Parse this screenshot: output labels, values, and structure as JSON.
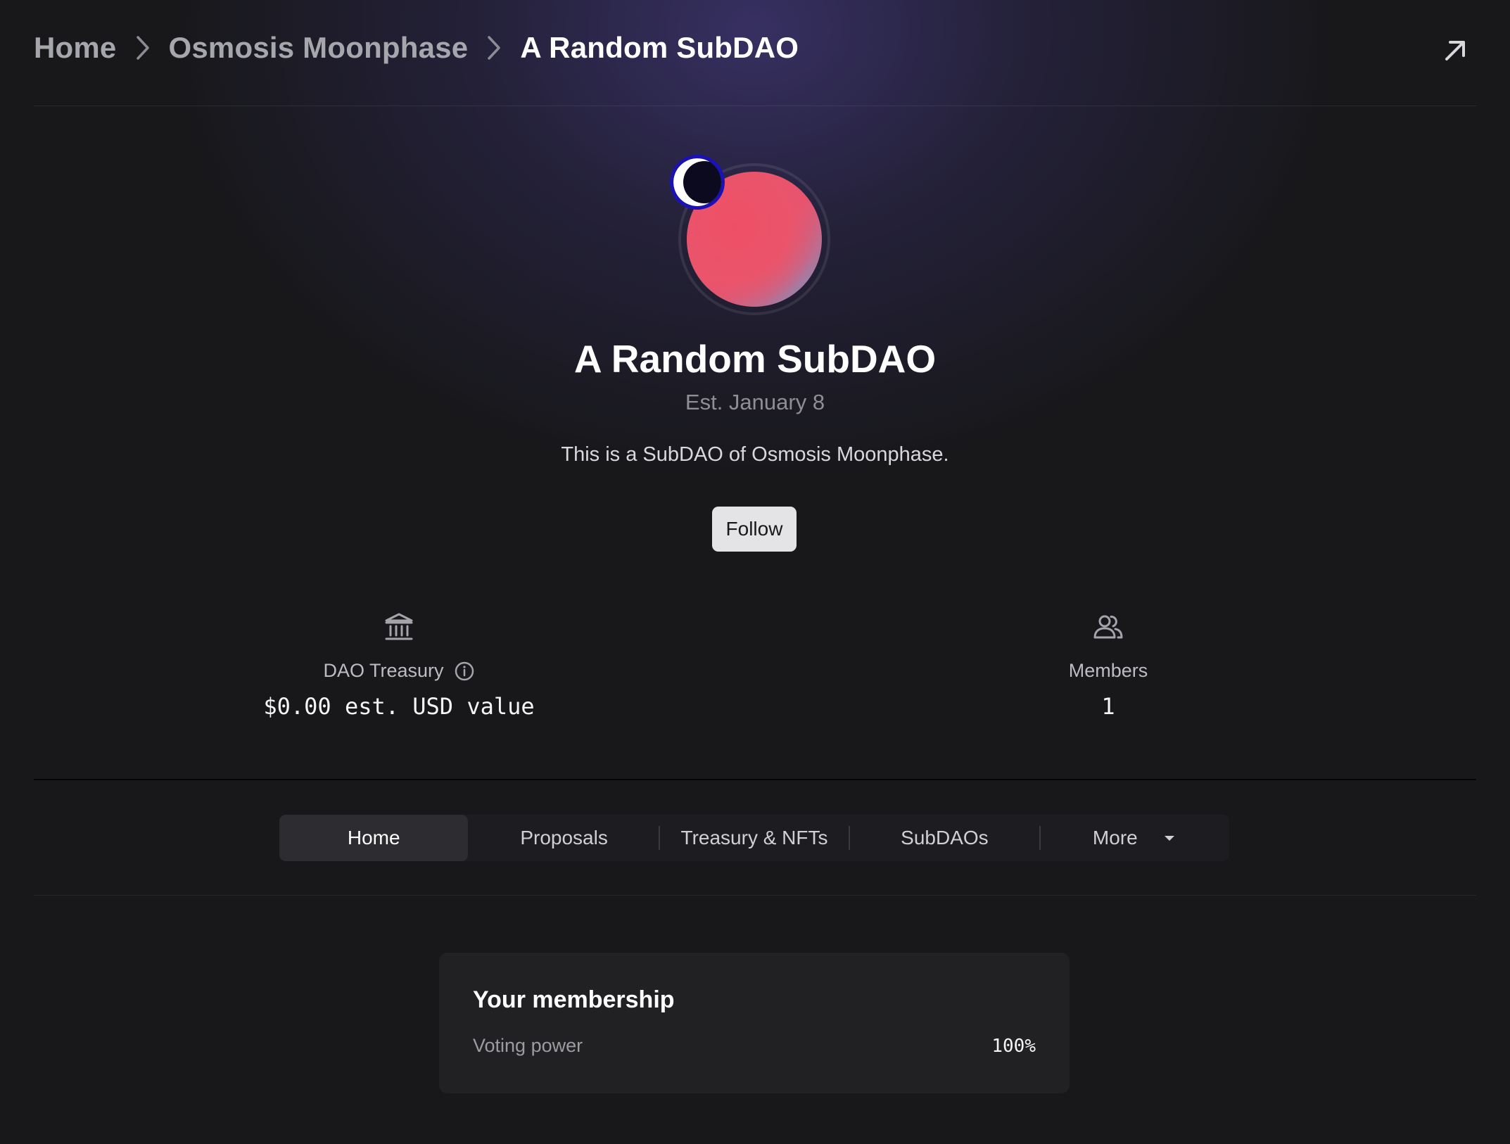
{
  "breadcrumb": {
    "items": [
      {
        "label": "Home"
      },
      {
        "label": "Osmosis Moonphase"
      },
      {
        "label": "A Random SubDAO"
      }
    ]
  },
  "icons": {
    "breadcrumb_separator": "chevron-right-icon",
    "external": "arrow-up-right-icon",
    "treasury": "bank-icon",
    "members": "people-icon",
    "info": "info-icon",
    "more": "caret-down-icon"
  },
  "dao": {
    "name": "A Random SubDAO",
    "established": "Est. January 8",
    "description": "This is a SubDAO of Osmosis Moonphase.",
    "follow_label": "Follow"
  },
  "stats": {
    "treasury": {
      "label": "DAO Treasury",
      "value": "$0.00 est. USD value"
    },
    "members": {
      "label": "Members",
      "value": "1"
    }
  },
  "tabs": [
    {
      "label": "Home",
      "active": true
    },
    {
      "label": "Proposals",
      "active": false
    },
    {
      "label": "Treasury & NFTs",
      "active": false
    },
    {
      "label": "SubDAOs",
      "active": false
    },
    {
      "label": "More",
      "active": false
    }
  ],
  "membership": {
    "title": "Your membership",
    "voting_power_label": "Voting power",
    "voting_power_value": "100%"
  },
  "colors": {
    "background": "#18181b",
    "accent_badge_border": "#1a12b8",
    "avatar_pink": "#ea546b",
    "avatar_blue": "#6f9ccd"
  }
}
